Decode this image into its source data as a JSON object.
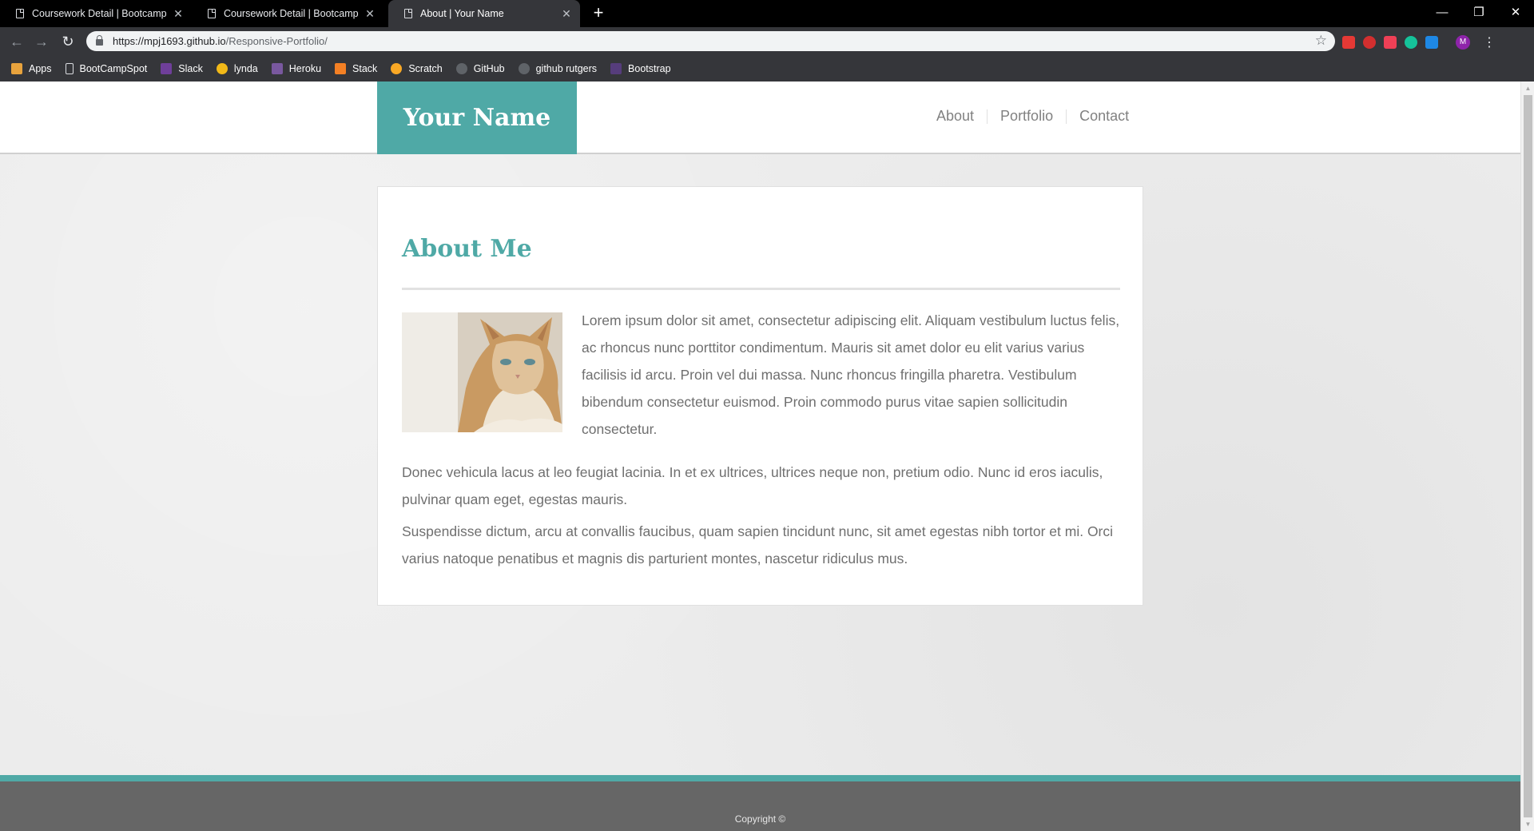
{
  "browser": {
    "tabs": [
      {
        "title": "Coursework Detail | Bootcamp Sp",
        "close": "✕"
      },
      {
        "title": "Coursework Detail | Bootcamp Sp",
        "close": "✕"
      },
      {
        "title": "About | Your Name",
        "close": "✕"
      }
    ],
    "new_tab": "+",
    "window_controls": {
      "minimize": "—",
      "restore": "❐",
      "close": "✕"
    },
    "nav": {
      "back": "←",
      "forward": "→",
      "reload": "↻"
    },
    "url": {
      "host": "https://mpj1693.github.io",
      "path": "/Responsive-Portfolio/"
    },
    "star": "☆",
    "profile_initial": "M",
    "menu": "⋮",
    "bookmarks": [
      {
        "label": "Apps",
        "icon": "apps-grid-icon",
        "color": "#e8a33d"
      },
      {
        "label": "BootCampSpot",
        "icon": "page-icon",
        "color": "#35363a"
      },
      {
        "label": "Slack",
        "icon": "slack-icon",
        "color": "#6f3f9a"
      },
      {
        "label": "lynda",
        "icon": "lynda-icon",
        "color": "#f2b918"
      },
      {
        "label": "Heroku",
        "icon": "heroku-icon",
        "color": "#79589f"
      },
      {
        "label": "Stack",
        "icon": "stack-icon",
        "color": "#f48024"
      },
      {
        "label": "Scratch",
        "icon": "scratch-icon",
        "color": "#f9a825"
      },
      {
        "label": "GitHub",
        "icon": "github-icon",
        "color": "#5f6368"
      },
      {
        "label": "github rutgers",
        "icon": "github-icon",
        "color": "#5f6368"
      },
      {
        "label": "Bootstrap",
        "icon": "bootstrap-icon",
        "color": "#563d7c"
      }
    ],
    "extensions": [
      {
        "icon": "video-extension-icon",
        "color": "#e53935"
      },
      {
        "icon": "adblock-icon",
        "color": "#d32f2f"
      },
      {
        "icon": "pocket-icon",
        "color": "#ef4056"
      },
      {
        "icon": "grammarly-icon",
        "color": "#15c39a"
      },
      {
        "icon": "skype-icon",
        "color": "#1e88e5"
      }
    ]
  },
  "site": {
    "brand": "Your Name",
    "nav": [
      "About",
      "Portfolio",
      "Contact"
    ],
    "accent_color": "#4fa9a6",
    "heading": "About Me",
    "paragraphs": [
      "Lorem ipsum dolor sit amet, consectetur adipiscing elit. Aliquam vestibulum luctus felis, ac rhoncus nunc porttitor condimentum. Mauris sit amet dolor eu elit varius varius facilisis id arcu. Proin vel dui massa. Nunc rhoncus fringilla pharetra. Vestibulum bibendum consectetur euismod. Proin commodo purus vitae sapien sollicitudin consectetur.",
      "Donec vehicula lacus at leo feugiat lacinia. In et ex ultrices, ultrices neque non, pretium odio. Nunc id eros iaculis, pulvinar quam eget, egestas mauris.",
      "Suspendisse dictum, arcu at convallis faucibus, quam sapien tincidunt nunc, sit amet egestas nibh tortor et mi. Orci varius natoque penatibus et magnis dis parturient montes, nascetur ridiculus mus."
    ],
    "footer": "Copyright ©"
  }
}
